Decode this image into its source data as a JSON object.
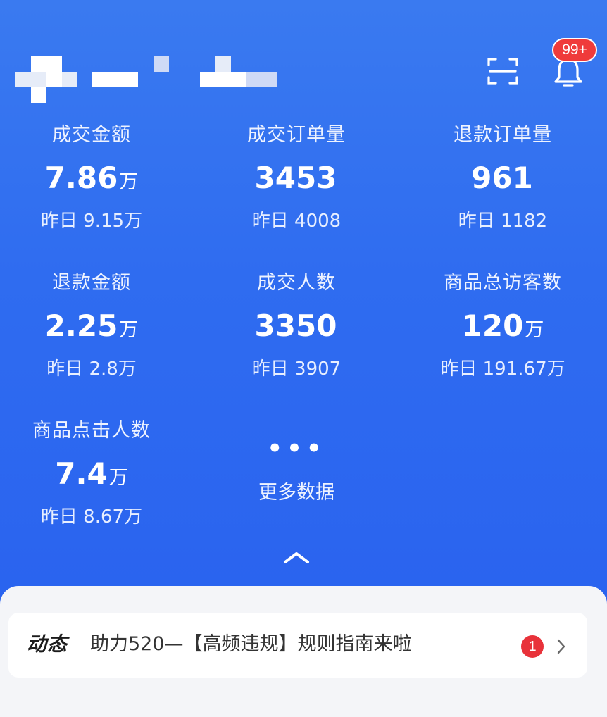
{
  "notifications": {
    "badge": "99+"
  },
  "stats": [
    {
      "label": "成交金额",
      "value": "7.86",
      "unit": "万",
      "prev": "昨日 9.15万"
    },
    {
      "label": "成交订单量",
      "value": "3453",
      "unit": "",
      "prev": "昨日 4008"
    },
    {
      "label": "退款订单量",
      "value": "961",
      "unit": "",
      "prev": "昨日 1182"
    },
    {
      "label": "退款金额",
      "value": "2.25",
      "unit": "万",
      "prev": "昨日 2.8万"
    },
    {
      "label": "成交人数",
      "value": "3350",
      "unit": "",
      "prev": "昨日 3907"
    },
    {
      "label": "商品总访客数",
      "value": "120",
      "unit": "万",
      "prev": "昨日 191.67万"
    },
    {
      "label": "商品点击人数",
      "value": "7.4",
      "unit": "万",
      "prev": "昨日 8.67万"
    }
  ],
  "more": {
    "dots": "•••",
    "label": "更多数据"
  },
  "news": {
    "tag": "动态",
    "text": "助力520—【高频违规】规则指南来啦",
    "count": "1"
  },
  "icons": {
    "scan": "scan-icon",
    "bell": "bell-icon",
    "collapse": "chevron-up-icon",
    "arrow": "chevron-right-icon"
  },
  "colors": {
    "header_blue": "#2f6cf0",
    "badge_red": "#ef3b3b"
  }
}
